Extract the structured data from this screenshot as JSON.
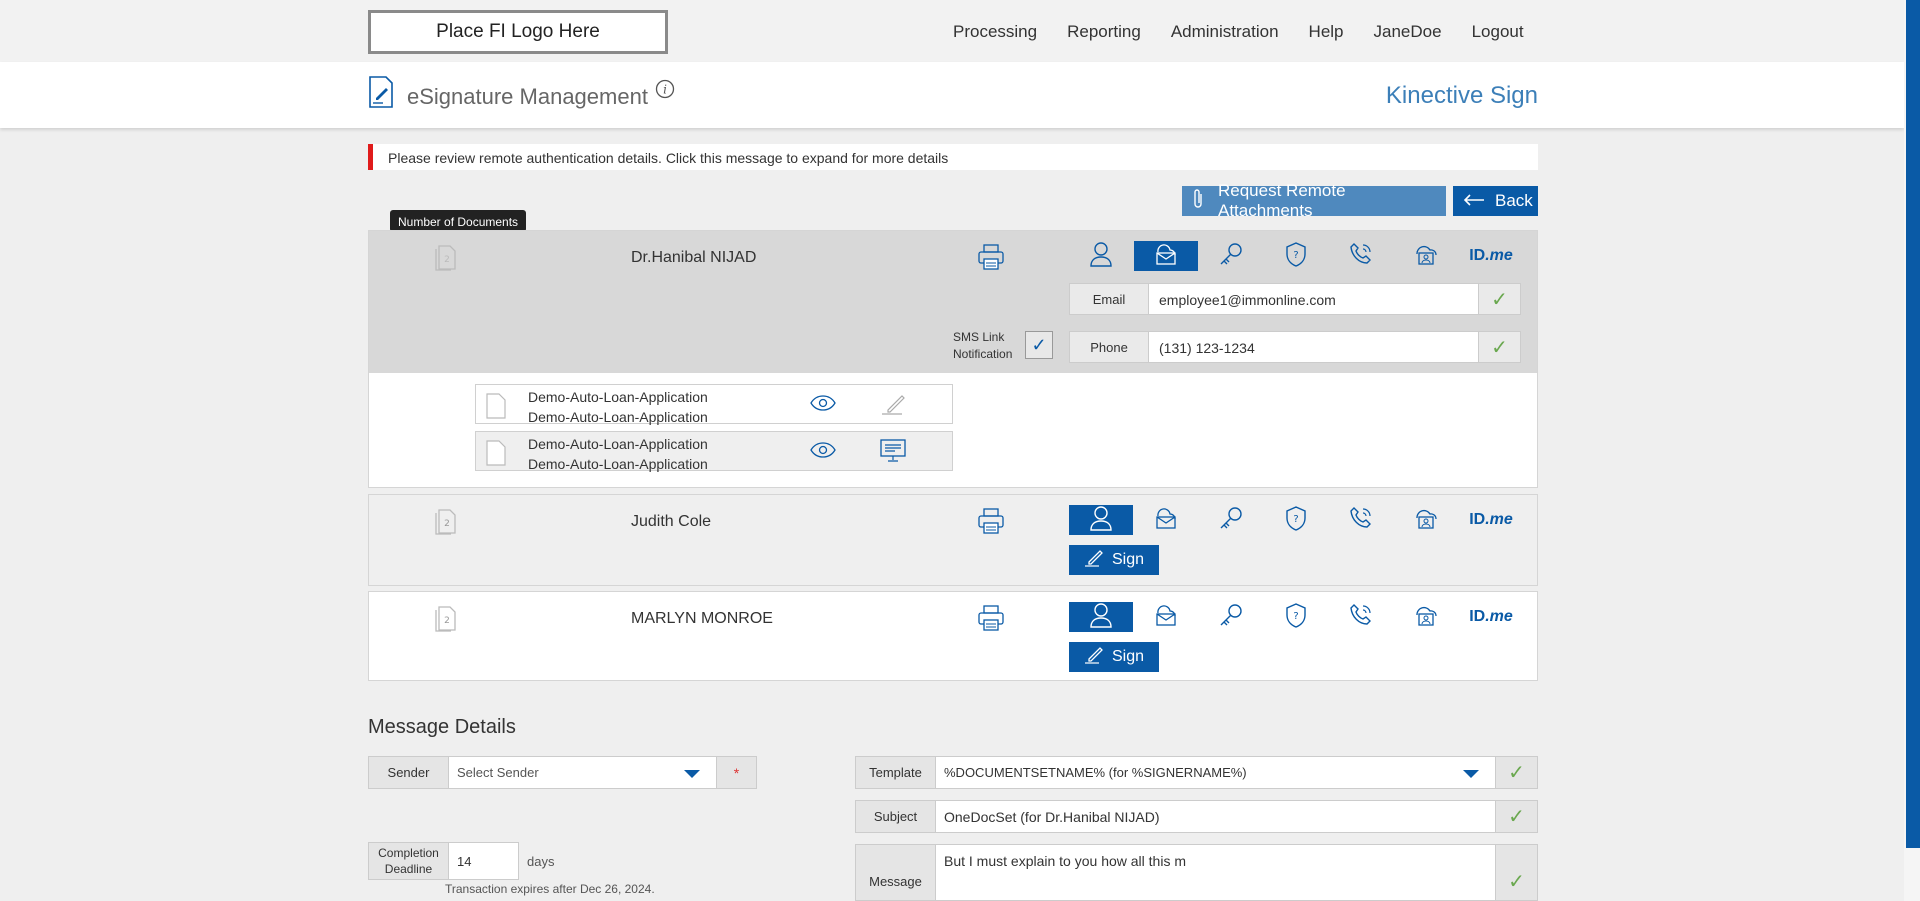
{
  "topbar": {
    "logo_text": "Place FI Logo Here",
    "nav": [
      "Processing",
      "Reporting",
      "Administration",
      "Help",
      "JaneDoe",
      "Logout"
    ]
  },
  "header": {
    "title": "eSignature Management",
    "brand": "Kinective Sign"
  },
  "alert": {
    "text": "Please review remote authentication details. Click this message to expand for more details"
  },
  "actions": {
    "request_remote_attachments": "Request Remote Attachments",
    "back": "Back"
  },
  "tooltip": "Number of Documents",
  "signers": [
    {
      "name": "Dr.Hanibal NIJAD",
      "page_count": "2",
      "auth_active": "email",
      "email_label": "Email",
      "email_value": "employee1@immonline.com",
      "phone_label": "Phone",
      "phone_value": "(131) 123-1234",
      "sms_label_line1": "SMS Link",
      "sms_label_line2": "Notification",
      "documents": [
        {
          "line1": "Demo-Auto-Loan-Application",
          "line2": "Demo-Auto-Loan-Application"
        },
        {
          "line1": "Demo-Auto-Loan-Application",
          "line2": "Demo-Auto-Loan-Application"
        }
      ]
    },
    {
      "name": "Judith Cole",
      "page_count": "2",
      "auth_active": "in-person",
      "sign_label": "Sign"
    },
    {
      "name": "MARLYN MONROE",
      "page_count": "2",
      "auth_active": "in-person",
      "sign_label": "Sign"
    }
  ],
  "idme": {
    "id": "ID",
    "me": ".me"
  },
  "message_details": {
    "title": "Message Details",
    "sender_label": "Sender",
    "sender_value": "Select Sender",
    "required_mark": "*",
    "template_label": "Template",
    "template_value": "%DOCUMENTSETNAME% (for %SIGNERNAME%)",
    "subject_label": "Subject",
    "subject_value": "OneDocSet (for Dr.Hanibal NIJAD)",
    "message_label": "Message",
    "message_value": "But I must explain to you how all this m",
    "deadline_label_line1": "Completion",
    "deadline_label_line2": "Deadline",
    "deadline_value": "14",
    "days_label": "days",
    "expires_text": "Transaction expires after Dec 26, 2024."
  },
  "colors": {
    "primary": "#0a5aa6",
    "alert": "#e01b1b",
    "check": "#6aa84f",
    "brand": "#3c7fb8"
  }
}
